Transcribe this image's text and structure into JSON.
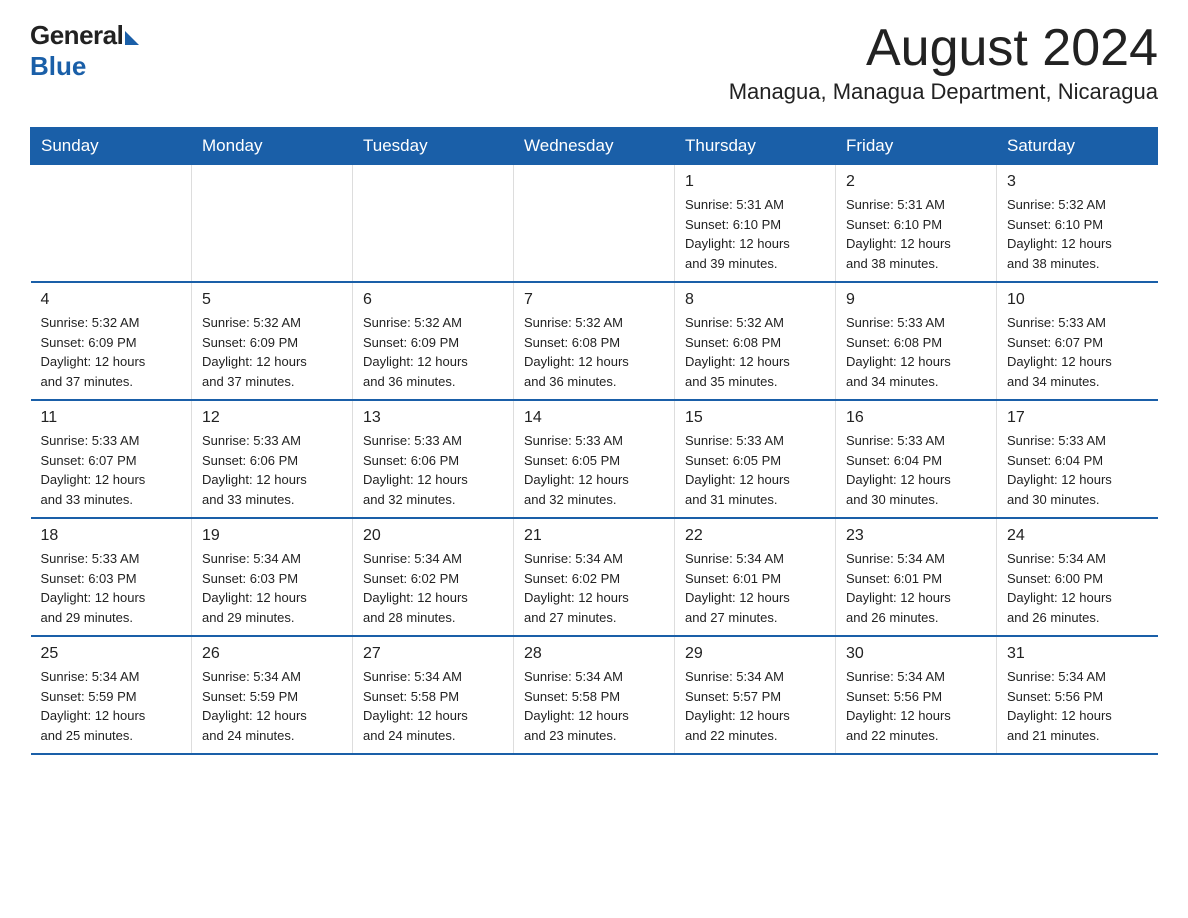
{
  "logo": {
    "general": "General",
    "blue": "Blue"
  },
  "title": "August 2024",
  "location": "Managua, Managua Department, Nicaragua",
  "weekdays": [
    "Sunday",
    "Monday",
    "Tuesday",
    "Wednesday",
    "Thursday",
    "Friday",
    "Saturday"
  ],
  "weeks": [
    [
      {
        "day": "",
        "info": ""
      },
      {
        "day": "",
        "info": ""
      },
      {
        "day": "",
        "info": ""
      },
      {
        "day": "",
        "info": ""
      },
      {
        "day": "1",
        "info": "Sunrise: 5:31 AM\nSunset: 6:10 PM\nDaylight: 12 hours\nand 39 minutes."
      },
      {
        "day": "2",
        "info": "Sunrise: 5:31 AM\nSunset: 6:10 PM\nDaylight: 12 hours\nand 38 minutes."
      },
      {
        "day": "3",
        "info": "Sunrise: 5:32 AM\nSunset: 6:10 PM\nDaylight: 12 hours\nand 38 minutes."
      }
    ],
    [
      {
        "day": "4",
        "info": "Sunrise: 5:32 AM\nSunset: 6:09 PM\nDaylight: 12 hours\nand 37 minutes."
      },
      {
        "day": "5",
        "info": "Sunrise: 5:32 AM\nSunset: 6:09 PM\nDaylight: 12 hours\nand 37 minutes."
      },
      {
        "day": "6",
        "info": "Sunrise: 5:32 AM\nSunset: 6:09 PM\nDaylight: 12 hours\nand 36 minutes."
      },
      {
        "day": "7",
        "info": "Sunrise: 5:32 AM\nSunset: 6:08 PM\nDaylight: 12 hours\nand 36 minutes."
      },
      {
        "day": "8",
        "info": "Sunrise: 5:32 AM\nSunset: 6:08 PM\nDaylight: 12 hours\nand 35 minutes."
      },
      {
        "day": "9",
        "info": "Sunrise: 5:33 AM\nSunset: 6:08 PM\nDaylight: 12 hours\nand 34 minutes."
      },
      {
        "day": "10",
        "info": "Sunrise: 5:33 AM\nSunset: 6:07 PM\nDaylight: 12 hours\nand 34 minutes."
      }
    ],
    [
      {
        "day": "11",
        "info": "Sunrise: 5:33 AM\nSunset: 6:07 PM\nDaylight: 12 hours\nand 33 minutes."
      },
      {
        "day": "12",
        "info": "Sunrise: 5:33 AM\nSunset: 6:06 PM\nDaylight: 12 hours\nand 33 minutes."
      },
      {
        "day": "13",
        "info": "Sunrise: 5:33 AM\nSunset: 6:06 PM\nDaylight: 12 hours\nand 32 minutes."
      },
      {
        "day": "14",
        "info": "Sunrise: 5:33 AM\nSunset: 6:05 PM\nDaylight: 12 hours\nand 32 minutes."
      },
      {
        "day": "15",
        "info": "Sunrise: 5:33 AM\nSunset: 6:05 PM\nDaylight: 12 hours\nand 31 minutes."
      },
      {
        "day": "16",
        "info": "Sunrise: 5:33 AM\nSunset: 6:04 PM\nDaylight: 12 hours\nand 30 minutes."
      },
      {
        "day": "17",
        "info": "Sunrise: 5:33 AM\nSunset: 6:04 PM\nDaylight: 12 hours\nand 30 minutes."
      }
    ],
    [
      {
        "day": "18",
        "info": "Sunrise: 5:33 AM\nSunset: 6:03 PM\nDaylight: 12 hours\nand 29 minutes."
      },
      {
        "day": "19",
        "info": "Sunrise: 5:34 AM\nSunset: 6:03 PM\nDaylight: 12 hours\nand 29 minutes."
      },
      {
        "day": "20",
        "info": "Sunrise: 5:34 AM\nSunset: 6:02 PM\nDaylight: 12 hours\nand 28 minutes."
      },
      {
        "day": "21",
        "info": "Sunrise: 5:34 AM\nSunset: 6:02 PM\nDaylight: 12 hours\nand 27 minutes."
      },
      {
        "day": "22",
        "info": "Sunrise: 5:34 AM\nSunset: 6:01 PM\nDaylight: 12 hours\nand 27 minutes."
      },
      {
        "day": "23",
        "info": "Sunrise: 5:34 AM\nSunset: 6:01 PM\nDaylight: 12 hours\nand 26 minutes."
      },
      {
        "day": "24",
        "info": "Sunrise: 5:34 AM\nSunset: 6:00 PM\nDaylight: 12 hours\nand 26 minutes."
      }
    ],
    [
      {
        "day": "25",
        "info": "Sunrise: 5:34 AM\nSunset: 5:59 PM\nDaylight: 12 hours\nand 25 minutes."
      },
      {
        "day": "26",
        "info": "Sunrise: 5:34 AM\nSunset: 5:59 PM\nDaylight: 12 hours\nand 24 minutes."
      },
      {
        "day": "27",
        "info": "Sunrise: 5:34 AM\nSunset: 5:58 PM\nDaylight: 12 hours\nand 24 minutes."
      },
      {
        "day": "28",
        "info": "Sunrise: 5:34 AM\nSunset: 5:58 PM\nDaylight: 12 hours\nand 23 minutes."
      },
      {
        "day": "29",
        "info": "Sunrise: 5:34 AM\nSunset: 5:57 PM\nDaylight: 12 hours\nand 22 minutes."
      },
      {
        "day": "30",
        "info": "Sunrise: 5:34 AM\nSunset: 5:56 PM\nDaylight: 12 hours\nand 22 minutes."
      },
      {
        "day": "31",
        "info": "Sunrise: 5:34 AM\nSunset: 5:56 PM\nDaylight: 12 hours\nand 21 minutes."
      }
    ]
  ]
}
